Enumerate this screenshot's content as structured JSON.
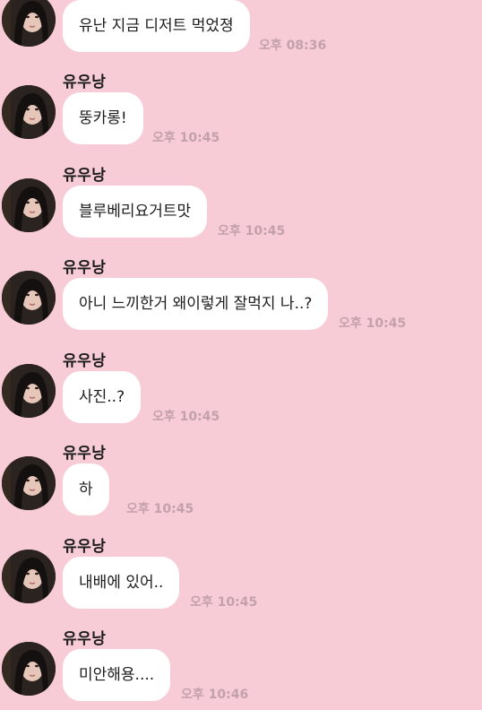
{
  "sender_name": "유우낭",
  "messages": [
    {
      "text": "유난 지금 디저트 먹었졍",
      "time": "오후 08:36"
    },
    {
      "text": "뚱카롱!",
      "time": "오후 10:45"
    },
    {
      "text": "블루베리요거트맛",
      "time": "오후 10:45"
    },
    {
      "text": "아니 느끼한거 왜이렇게 잘먹지 나..?",
      "time": "오후 10:45"
    },
    {
      "text": "사진..?",
      "time": "오후 10:45"
    },
    {
      "text": "하",
      "time": "오후 10:45"
    },
    {
      "text": "내배에 있어..",
      "time": "오후 10:45"
    },
    {
      "text": "미안해용....",
      "time": "오후 10:46"
    }
  ]
}
